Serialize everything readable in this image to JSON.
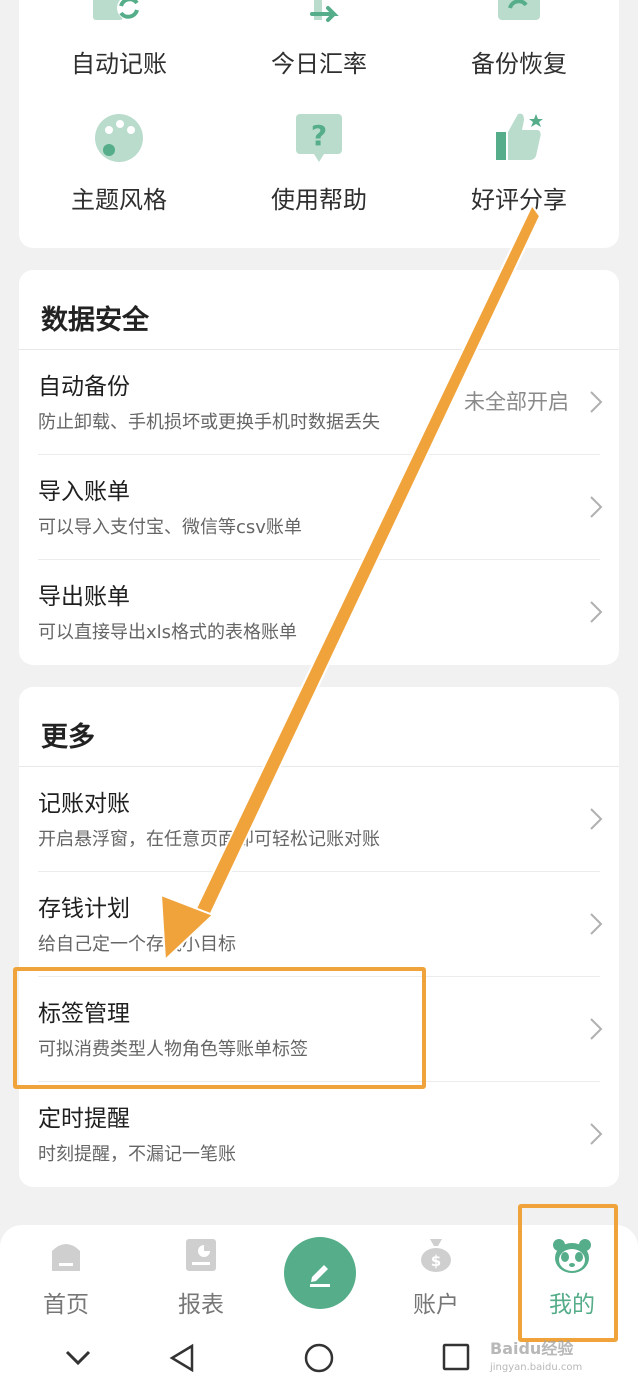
{
  "tools": [
    {
      "label": "自动记账",
      "icon": "auto-bookkeeping-icon"
    },
    {
      "label": "今日汇率",
      "icon": "exchange-rate-icon"
    },
    {
      "label": "备份恢复",
      "icon": "backup-restore-icon"
    },
    {
      "label": "主题风格",
      "icon": "palette-icon"
    },
    {
      "label": "使用帮助",
      "icon": "help-icon"
    },
    {
      "label": "好评分享",
      "icon": "thumbs-up-icon"
    }
  ],
  "data_security": {
    "title": "数据安全",
    "items": [
      {
        "title": "自动备份",
        "desc": "防止卸载、手机损坏或更换手机时数据丢失",
        "value": "未全部开启"
      },
      {
        "title": "导入账单",
        "desc": "可以导入支付宝、微信等csv账单"
      },
      {
        "title": "导出账单",
        "desc": "可以直接导出xls格式的表格账单"
      }
    ]
  },
  "more": {
    "title": "更多",
    "items": [
      {
        "title": "记账对账",
        "desc": "开启悬浮窗，在任意页面即可轻松记账对账"
      },
      {
        "title": "存钱计划",
        "desc": "给自己定一个存钱小目标"
      },
      {
        "title": "标签管理",
        "desc": "可拟消费类型人物角色等账单标签"
      },
      {
        "title": "定时提醒",
        "desc": "时刻提醒，不漏记一笔账"
      }
    ]
  },
  "bottom_nav": [
    {
      "label": "首页",
      "icon": "home-icon"
    },
    {
      "label": "报表",
      "icon": "report-icon"
    },
    {
      "label": "",
      "icon": "pencil-icon"
    },
    {
      "label": "账户",
      "icon": "money-bag-icon"
    },
    {
      "label": "我的",
      "icon": "panda-icon"
    }
  ],
  "colors": {
    "accent": "#55ad8a",
    "icon_light": "#b9dccd",
    "annotation": "#f0a33a"
  },
  "watermark": {
    "text": "Baidu经验",
    "url": "jingyan.baidu.com"
  }
}
